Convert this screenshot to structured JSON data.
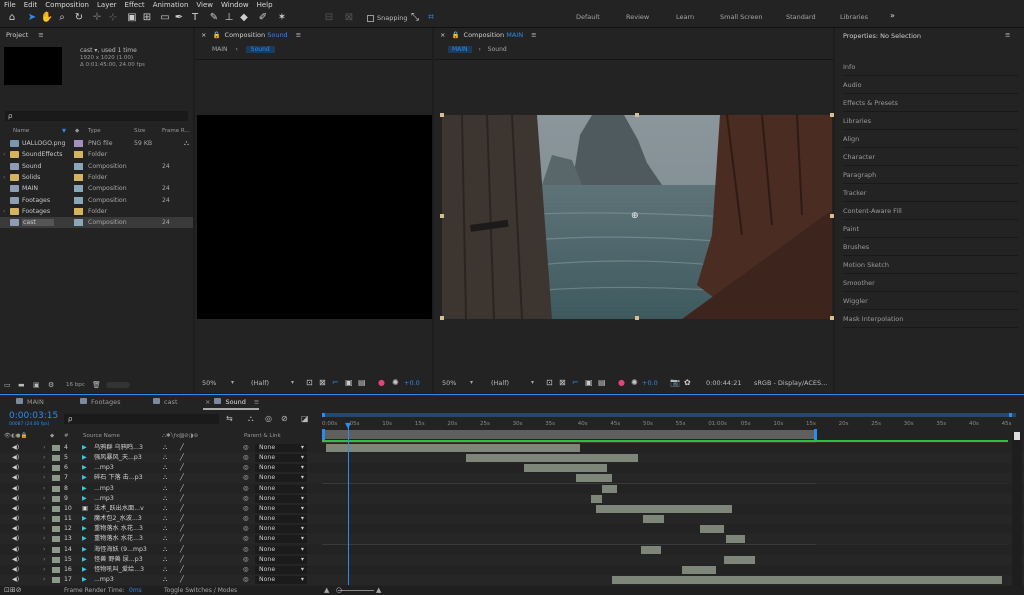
{
  "menu": [
    "File",
    "Edit",
    "Composition",
    "Layer",
    "Effect",
    "Animation",
    "View",
    "Window",
    "Help"
  ],
  "toolbar": {
    "snapping_label": "Snapping"
  },
  "workspaces": [
    "Default",
    "Review",
    "Learn",
    "Small Screen",
    "Standard",
    "Libraries"
  ],
  "workspace_more": "»",
  "project": {
    "title": "Project",
    "menu_icon": "≡",
    "item_name": "cast",
    "item_used": ", used 1 time",
    "item_dims": "1920 x 1020 (1.00)",
    "item_dur": "Δ 0:01:45:00, 24.00 fps",
    "search_prefix": "ρ",
    "columns": {
      "name": "Name",
      "type": "Type",
      "size": "Size",
      "frame": "Frame R..."
    },
    "items": [
      {
        "name": "UALLOGO.png",
        "type": "PNG file",
        "size": "59 KB",
        "frame": "",
        "icon": "image-icon"
      },
      {
        "name": "SoundEffects",
        "type": "Folder",
        "size": "",
        "frame": "",
        "icon": "folder-icon"
      },
      {
        "name": "Sound",
        "type": "Composition",
        "size": "",
        "frame": "24",
        "icon": "composition-icon"
      },
      {
        "name": "Solids",
        "type": "Folder",
        "size": "",
        "frame": "",
        "icon": "folder-icon"
      },
      {
        "name": "MAIN",
        "type": "Composition",
        "size": "",
        "frame": "24",
        "icon": "composition-icon"
      },
      {
        "name": "Footages",
        "type": "Composition",
        "size": "",
        "frame": "24",
        "icon": "composition-icon"
      },
      {
        "name": "Footages",
        "type": "Folder",
        "size": "",
        "frame": "",
        "icon": "folder-icon"
      },
      {
        "name": "cast",
        "type": "Composition",
        "size": "",
        "frame": "24",
        "icon": "composition-icon"
      }
    ],
    "bpc": "16 bpc"
  },
  "comp_left": {
    "prefix": "Composition",
    "name": "Sound",
    "crumb1": "MAIN",
    "crumb2": "Sound",
    "zoom": "50%",
    "res": "(Half)",
    "exposure": "+0.0"
  },
  "comp_right": {
    "prefix": "Composition",
    "name": "MAIN",
    "crumb1": "MAIN",
    "crumb2": "Sound",
    "zoom": "50%",
    "res": "(Half)",
    "exposure": "+0.0",
    "timecode": "0:00:44:21",
    "color": "sRGB - Display/ACES..."
  },
  "properties": {
    "title": "Properties: No Selection",
    "items": [
      "Info",
      "Audio",
      "Effects & Presets",
      "Libraries",
      "Align",
      "Character",
      "Paragraph",
      "Tracker",
      "Content-Aware Fill",
      "Paint",
      "Brushes",
      "Motion Sketch",
      "Smoother",
      "Wiggler",
      "Mask Interpolation"
    ]
  },
  "timeline": {
    "tabs": [
      "MAIN",
      "Footages",
      "cast",
      "Sound"
    ],
    "timecode": "0:00:03:15",
    "fps": "00087 (24.00 fps)",
    "search_prefix": "ρ",
    "col_source": "Source Name",
    "col_parent": "Parent & Link",
    "col_num": "#",
    "ticks": [
      "0:00s",
      "05s",
      "10s",
      "15s",
      "20s",
      "25s",
      "30s",
      "35s",
      "40s",
      "45s",
      "50s",
      "55s",
      "01:00s",
      "05s",
      "10s",
      "15s",
      "20s",
      "25s",
      "30s",
      "35s",
      "40s",
      "45s"
    ],
    "layers": [
      {
        "num": "4",
        "name": "乌鸦群 乌鸦鸣...3",
        "parent": "None",
        "start": 0.0,
        "end": 19.5,
        "icon": "audio-icon"
      },
      {
        "num": "5",
        "name": "强风暴风_天...p3",
        "parent": "None",
        "start": 10.8,
        "end": 24.0,
        "icon": "audio-icon"
      },
      {
        "num": "6",
        "name": "...mp3",
        "parent": "None",
        "start": 15.2,
        "end": 21.6,
        "icon": "audio-icon"
      },
      {
        "num": "7",
        "name": "碎石 下落 击...p3",
        "parent": "None",
        "start": 19.2,
        "end": 22.0,
        "icon": "audio-icon"
      },
      {
        "num": "8",
        "name": "...mp3",
        "parent": "None",
        "start": 21.2,
        "end": 22.4,
        "icon": "audio-icon"
      },
      {
        "num": "9",
        "name": "...mp3",
        "parent": "None",
        "start": 20.4,
        "end": 21.2,
        "icon": "audio-icon"
      },
      {
        "num": "10",
        "name": "法术_跃出水面...v",
        "parent": "None",
        "start": 20.8,
        "end": 31.2,
        "icon": "video-icon"
      },
      {
        "num": "11",
        "name": "魔术包2_水波...3",
        "parent": "None",
        "start": 24.4,
        "end": 26.0,
        "icon": "audio-icon"
      },
      {
        "num": "12",
        "name": "重物落水 水花...3",
        "parent": "None",
        "start": 28.8,
        "end": 30.6,
        "icon": "audio-icon"
      },
      {
        "num": "13",
        "name": "重物落水 水花...3",
        "parent": "None",
        "start": 30.8,
        "end": 32.2,
        "icon": "audio-icon"
      },
      {
        "num": "14",
        "name": "海怪海妖 (9...mp3",
        "parent": "None",
        "start": 24.2,
        "end": 25.8,
        "icon": "audio-icon"
      },
      {
        "num": "15",
        "name": "怪兽 野兽 尿...p3",
        "parent": "None",
        "start": 30.6,
        "end": 33.0,
        "icon": "audio-icon"
      },
      {
        "num": "16",
        "name": "怪物吼叫_爱给...3",
        "parent": "None",
        "start": 27.4,
        "end": 30.0,
        "icon": "audio-icon"
      },
      {
        "num": "17",
        "name": "...mp3",
        "parent": "None",
        "start": 22.0,
        "end": 52.0,
        "icon": "audio-icon"
      }
    ],
    "render_label": "Frame Render Time:",
    "render_value": "0ms",
    "toggle_label": "Toggle Switches / Modes"
  }
}
